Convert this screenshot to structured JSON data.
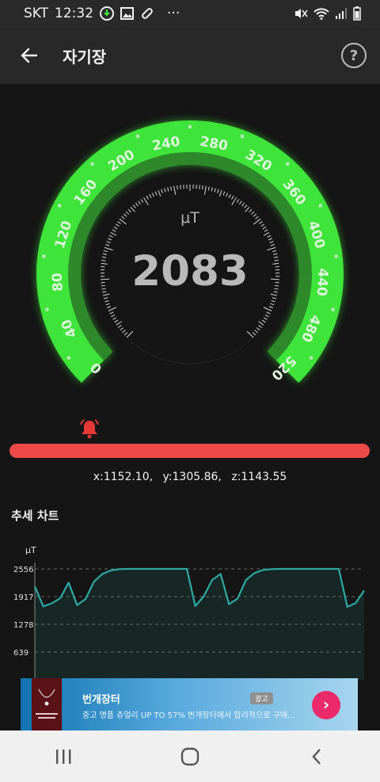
{
  "status_bar": {
    "carrier": "SKT",
    "time": "12:32",
    "more": "···"
  },
  "app_bar": {
    "title": "자기장",
    "help": "?"
  },
  "gauge": {
    "value": "2083",
    "unit": "μT",
    "scale_labels": [
      "0",
      "40",
      "80",
      "120",
      "160",
      "200",
      "240",
      "280",
      "320",
      "360",
      "400",
      "440",
      "480",
      "520"
    ],
    "scale_min": 0,
    "scale_max": 520,
    "arc_color": "#3ee43a"
  },
  "level": {
    "fraction": 1.0,
    "color": "#ef4a4a"
  },
  "coords": {
    "x": "x:1152.10,",
    "y": "y:1305.86,",
    "z": "z:1143.55"
  },
  "trend": {
    "title": "추세 차트"
  },
  "chart_data": {
    "type": "area",
    "ylabel": "μT",
    "yticks": [
      "2556",
      "1917",
      "1278",
      "639"
    ],
    "ylim": [
      0,
      2556
    ],
    "grid": true,
    "line_color": "#2ba9a2",
    "values": [
      2150,
      1690,
      1760,
      1880,
      2240,
      1720,
      1860,
      2260,
      2440,
      2520,
      2550,
      2556,
      2556,
      2556,
      2556,
      2556,
      2556,
      2556,
      2556,
      1700,
      1920,
      2300,
      2440,
      1740,
      1870,
      2300,
      2460,
      2530,
      2550,
      2556,
      2556,
      2556,
      2556,
      2556,
      2556,
      2556,
      2556,
      1680,
      1770,
      2060
    ]
  },
  "ad": {
    "name": "번개장터",
    "text": "중고 명품 쥬얼리 UP TO 57% 번개장터에서 합리적으로 구매...",
    "badge": "광고",
    "cta": "›"
  }
}
